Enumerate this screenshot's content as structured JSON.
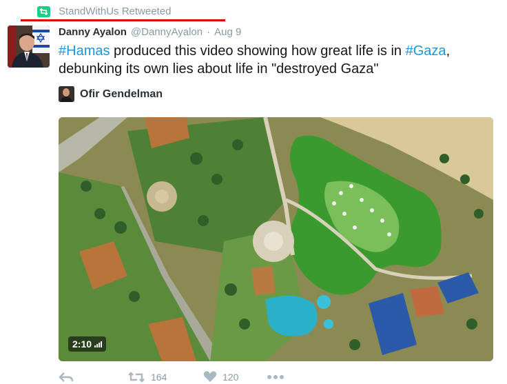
{
  "retweet": {
    "label": "StandWithUs Retweeted",
    "icon": "retweet-icon",
    "icon_color": "#19cf86",
    "underline_color": "#d90000"
  },
  "tweet": {
    "fullname": "Danny Ayalon",
    "username": "@DannyAyalon",
    "separator": "·",
    "time": "Aug 9",
    "text": {
      "hashtag1": "#Hamas",
      "part1": " produced this video showing how great life is in ",
      "hashtag2": "#Gaza",
      "part2": ",",
      "line2": "debunking its own lies about life in \"destroyed Gaza\""
    },
    "hashtag_color": "#1b95e0"
  },
  "quote": {
    "name": "Ofir Gendelman"
  },
  "media": {
    "type": "video",
    "duration": "2:10"
  },
  "actions": {
    "reply_icon": "reply-icon",
    "retweet_icon": "retweet-icon",
    "retweet_count": "164",
    "like_icon": "heart-icon",
    "like_count": "120",
    "more_icon": "more-icon"
  }
}
